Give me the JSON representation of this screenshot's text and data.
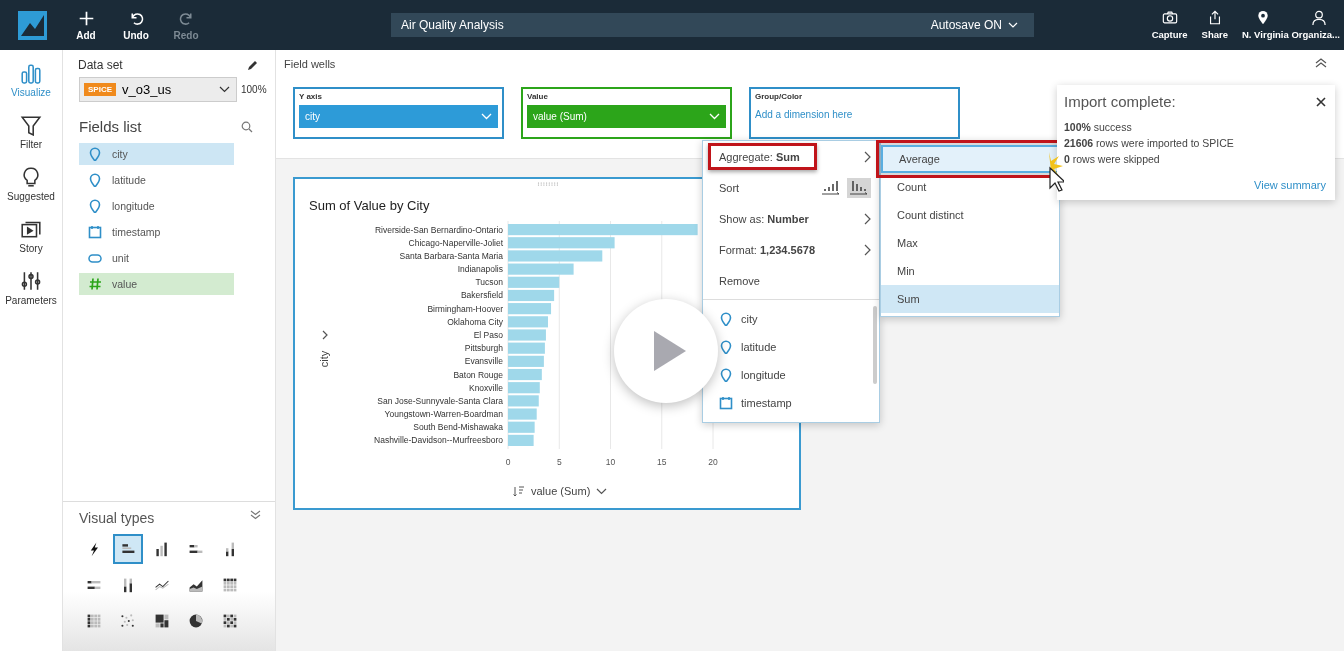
{
  "top_bar": {
    "buttons": [
      {
        "label": "Add",
        "kind": "add",
        "disabled": false
      },
      {
        "label": "Undo",
        "kind": "undo",
        "disabled": false
      },
      {
        "label": "Redo",
        "kind": "redo",
        "disabled": true
      }
    ],
    "analysis_title": "Air Quality Analysis",
    "autosave": "Autosave ON",
    "actions": [
      {
        "label": "Capture",
        "kind": "camera"
      },
      {
        "label": "Share",
        "kind": "share"
      },
      {
        "label": "N. Virginia Organiza...",
        "kind": "region"
      }
    ]
  },
  "nav": [
    {
      "label": "Visualize",
      "kind": "visualize",
      "selected": true
    },
    {
      "label": "Filter",
      "kind": "filter",
      "selected": false
    },
    {
      "label": "Suggested",
      "kind": "suggested",
      "selected": false
    },
    {
      "label": "Story",
      "kind": "story",
      "selected": false
    },
    {
      "label": "Parameters",
      "kind": "parameters",
      "selected": false
    }
  ],
  "dataset": {
    "heading": "Data set",
    "badge": "SPICE",
    "name": "v_o3_us",
    "percent": "100%"
  },
  "fields": {
    "heading": "Fields list",
    "items": [
      {
        "name": "city",
        "kind": "geo",
        "in_use": true
      },
      {
        "name": "latitude",
        "kind": "geo",
        "in_use": false
      },
      {
        "name": "longitude",
        "kind": "geo",
        "in_use": false
      },
      {
        "name": "timestamp",
        "kind": "date",
        "in_use": false
      },
      {
        "name": "unit",
        "kind": "string",
        "in_use": false
      },
      {
        "name": "value",
        "kind": "number",
        "in_use": true
      }
    ]
  },
  "visual_types": {
    "heading": "Visual types",
    "items": [
      {
        "kind": "autograph",
        "selected": false
      },
      {
        "kind": "hbar",
        "selected": true
      },
      {
        "kind": "vbar",
        "selected": false
      },
      {
        "kind": "hstacked",
        "selected": false
      },
      {
        "kind": "vstacked",
        "selected": false
      },
      {
        "kind": "hpercent",
        "selected": false
      },
      {
        "kind": "vpercent",
        "selected": false
      },
      {
        "kind": "line",
        "selected": false
      },
      {
        "kind": "area",
        "selected": false
      },
      {
        "kind": "pivot",
        "selected": false
      },
      {
        "kind": "heatmap",
        "selected": false
      },
      {
        "kind": "scatter",
        "selected": false
      },
      {
        "kind": "treemap",
        "selected": false
      },
      {
        "kind": "pie",
        "selected": false
      },
      {
        "kind": "table",
        "selected": false
      }
    ]
  },
  "field_wells": {
    "heading": "Field wells",
    "wells": [
      {
        "label": "Y axis",
        "kind": "dimension",
        "value": "city"
      },
      {
        "label": "Value",
        "kind": "measure",
        "value": "value (Sum)"
      },
      {
        "label": "Group/Color",
        "kind": "empty",
        "hint": "Add a dimension here"
      }
    ]
  },
  "visual": {
    "chart_data": {
      "type": "bar",
      "orientation": "horizontal",
      "title": "Sum of Value by City",
      "xlabel": "value (Sum)",
      "ylabel": "city",
      "categories": [
        "Riverside-San Bernardino-Ontario",
        "Chicago-Naperville-Joliet",
        "Santa Barbara-Santa Maria",
        "Indianapolis",
        "Tucson",
        "Bakersfield",
        "Birmingham-Hoover",
        "Oklahoma City",
        "El Paso",
        "Pittsburgh",
        "Evansville",
        "Baton Rouge",
        "Knoxville",
        "San Jose-Sunnyvale-Santa Clara",
        "Youngstown-Warren-Boardman",
        "South Bend-Mishawaka",
        "Nashville-Davidson--Murfreesboro"
      ],
      "values": [
        18.5,
        10.4,
        9.2,
        6.4,
        5.0,
        4.5,
        4.2,
        3.9,
        3.7,
        3.6,
        3.5,
        3.3,
        3.1,
        3.0,
        2.8,
        2.6,
        2.5
      ],
      "xlim": [
        0,
        20
      ],
      "xticks": [
        0,
        5,
        10,
        15,
        20
      ],
      "grid": true
    }
  },
  "field_menu": {
    "items": [
      {
        "kind": "submenu",
        "label": "Aggregate: **Sum**",
        "boxed": true
      },
      {
        "kind": "sort",
        "label": "Sort",
        "options": [
          {
            "kind": "ascending",
            "selected": false
          },
          {
            "kind": "descending",
            "selected": true
          }
        ]
      },
      {
        "kind": "submenu",
        "label": "Show as:  **Number**",
        "boxed": false
      },
      {
        "kind": "submenu",
        "label": "Format: **1,234.5678**",
        "boxed": false
      },
      {
        "kind": "action",
        "label": "Remove"
      }
    ],
    "fields": [
      {
        "name": "city",
        "kind": "geo"
      },
      {
        "name": "latitude",
        "kind": "geo"
      },
      {
        "name": "longitude",
        "kind": "geo"
      },
      {
        "name": "timestamp",
        "kind": "date"
      }
    ]
  },
  "aggregate_menu": {
    "items": [
      {
        "label": "Average",
        "highlighted": true,
        "selected": false,
        "boxed": true
      },
      {
        "label": "Count",
        "highlighted": false,
        "selected": false,
        "boxed": false
      },
      {
        "label": "Count distinct",
        "highlighted": false,
        "selected": false,
        "boxed": false
      },
      {
        "label": "Max",
        "highlighted": false,
        "selected": false,
        "boxed": false
      },
      {
        "label": "Min",
        "highlighted": false,
        "selected": false,
        "boxed": false
      },
      {
        "label": "Sum",
        "highlighted": false,
        "selected": true,
        "boxed": false
      }
    ]
  },
  "notification": {
    "title": "Import complete:",
    "lines": [
      "**100%** success",
      "**21606** rows were imported to SPICE",
      "**0** rows were skipped"
    ],
    "link": "View summary"
  }
}
